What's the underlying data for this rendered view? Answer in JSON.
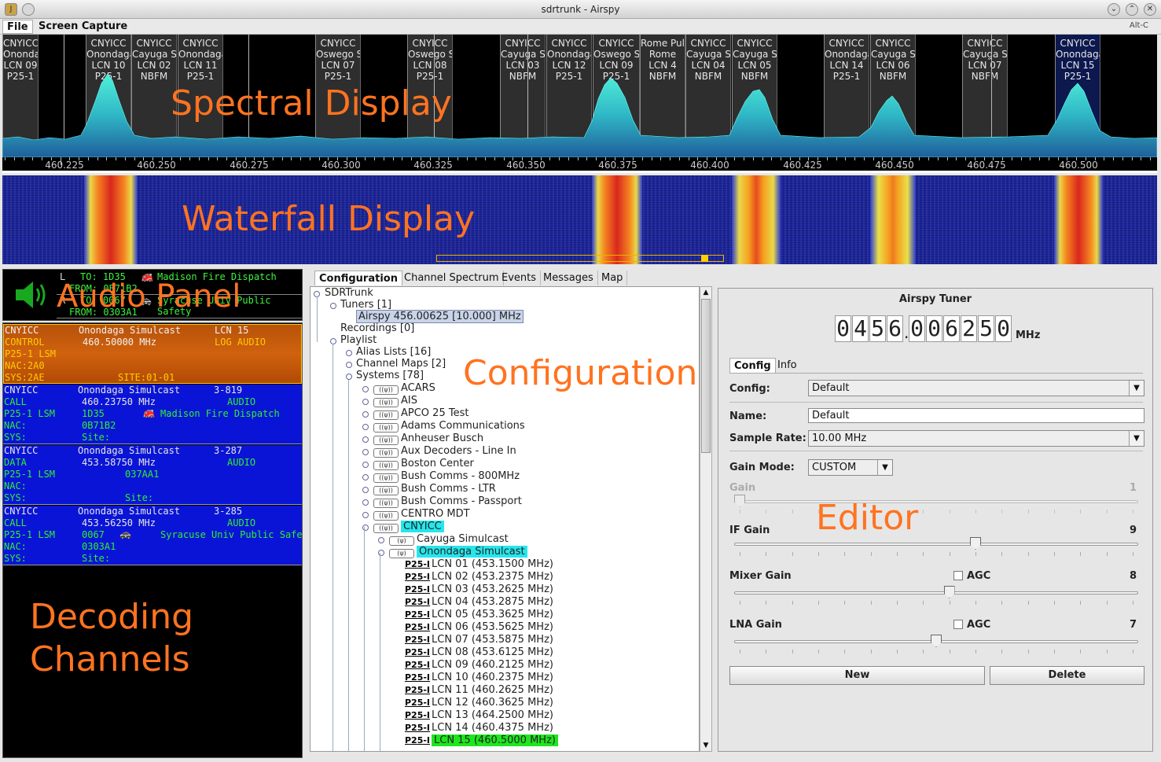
{
  "window": {
    "title": "sdrtrunk - Airspy"
  },
  "menu": {
    "file": "File",
    "screen_capture": "Screen Capture",
    "shortcut": "Alt-C"
  },
  "overlays": {
    "spectral": "Spectral Display",
    "waterfall": "Waterfall Display",
    "audio": "Audio Panel",
    "configuration": "Configuration",
    "editor": "Editor",
    "decoding_line1": "Decoding",
    "decoding_line2": "Channels"
  },
  "spectrum": {
    "frequencies": [
      "460.225",
      "460.250",
      "460.275",
      "460.300",
      "460.325",
      "460.350",
      "460.375",
      "460.400",
      "460.425",
      "460.450",
      "460.475",
      "460.500"
    ],
    "channels": [
      {
        "l1": "CNYICC",
        "l2": "Onondaga",
        "l3": "LCN 09",
        "l4": "P25-1",
        "sel": false
      },
      {
        "l1": "CNYICC",
        "l2": "Onondaga",
        "l3": "LCN 10",
        "l4": "P25-1",
        "sel": false
      },
      {
        "l1": "CNYICC",
        "l2": "Cayuga S",
        "l3": "LCN 02",
        "l4": "NBFM",
        "sel": false
      },
      {
        "l1": "CNYICC",
        "l2": "Onondaga",
        "l3": "LCN 11",
        "l4": "P25-1",
        "sel": false
      },
      {
        "l1": "CNYICC",
        "l2": "Oswego S",
        "l3": "LCN 07",
        "l4": "P25-1",
        "sel": false
      },
      {
        "l1": "CNYICC",
        "l2": "Oswego S",
        "l3": "LCN 08",
        "l4": "P25-1",
        "sel": false
      },
      {
        "l1": "CNYICC",
        "l2": "Cayuga S",
        "l3": "LCN 03",
        "l4": "NBFM",
        "sel": false
      },
      {
        "l1": "CNYICC",
        "l2": "Onondaga",
        "l3": "LCN 12",
        "l4": "P25-1",
        "sel": false
      },
      {
        "l1": "CNYICC",
        "l2": "Oswego S",
        "l3": "LCN 09",
        "l4": "P25-1",
        "sel": false
      },
      {
        "l1": "Rome Pul",
        "l2": "Rome",
        "l3": "LCN 4",
        "l4": "NBFM",
        "sel": false
      },
      {
        "l1": "CNYICC",
        "l2": "Cayuga S",
        "l3": "LCN 04",
        "l4": "NBFM",
        "sel": false
      },
      {
        "l1": "CNYICC",
        "l2": "Cayuga S",
        "l3": "LCN 05",
        "l4": "NBFM",
        "sel": false
      },
      {
        "l1": "CNYICC",
        "l2": "Onondaga",
        "l3": "LCN 14",
        "l4": "P25-1",
        "sel": false
      },
      {
        "l1": "CNYICC",
        "l2": "Cayuga S",
        "l3": "LCN 06",
        "l4": "NBFM",
        "sel": false
      },
      {
        "l1": "CNYICC",
        "l2": "Cayuga S",
        "l3": "LCN 07",
        "l4": "NBFM",
        "sel": false
      },
      {
        "l1": "CNYICC",
        "l2": "Onondaga",
        "l3": "LCN 15",
        "l4": "P25-1",
        "sel": true
      }
    ]
  },
  "audio": {
    "row1": {
      "ch": "L",
      "to": "TO: 1D35",
      "alias": "Madison Fire Dispatch",
      "from": "FROM: 0B71B2"
    },
    "row2": {
      "ch": "R",
      "to": "TO: 0067",
      "alias": "Syracuse Univ Public Safety",
      "from": "FROM: 0303A1"
    }
  },
  "decode": [
    {
      "l1a": "CNYICC",
      "l1b": "Onondaga Simulcast",
      "l1c": "LCN 15",
      "l2a": "CONTROL",
      "l2b": "460.50000 MHz",
      "l2c": "LOG AUDIO",
      "l3a": "P25-1 LSM",
      "l3b": "",
      "l3c": "",
      "l4a": "NAC:2A0",
      "l4b": "",
      "l5a": "SYS:2AE",
      "l5b": "SITE:01-01"
    },
    {
      "l1a": "CNYICC",
      "l1b": "Onondaga Simulcast",
      "l1c": "3-819",
      "l2a": "CALL",
      "l2b": "460.23750 MHz",
      "l2c": "AUDIO",
      "l3a": "P25-1 LSM",
      "l3b": "1D35",
      "l3c": "Madison Fire Dispatch",
      "l4a": "NAC:",
      "l4b": "0B71B2",
      "l5a": "SYS:",
      "l5b": "Site:"
    },
    {
      "l1a": "CNYICC",
      "l1b": "Onondaga Simulcast",
      "l1c": "3-287",
      "l2a": "DATA",
      "l2b": "453.58750 MHz",
      "l2c": "AUDIO",
      "l3a": "P25-1 LSM",
      "l3b": "037AA1",
      "l3c": "",
      "l4a": "NAC:",
      "l4b": "",
      "l5a": "SYS:",
      "l5b": "Site:"
    },
    {
      "l1a": "CNYICC",
      "l1b": "Onondaga Simulcast",
      "l1c": "3-285",
      "l2a": "CALL",
      "l2b": "453.56250 MHz",
      "l2c": "AUDIO",
      "l3a": "P25-1 LSM",
      "l3b": "0067",
      "l3c": "Syracuse Univ Public Safety",
      "l4a": "NAC:",
      "l4b": "0303A1",
      "l5a": "SYS:",
      "l5b": "Site:"
    }
  ],
  "tabs": [
    "Configuration",
    "Channel Spectrum",
    "Events",
    "Messages",
    "Map"
  ],
  "tree": {
    "root": "SDRTrunk",
    "tuners": "Tuners [1]",
    "airspy": "Airspy  456.00625 [10.000] MHz",
    "recordings": "Recordings [0]",
    "playlist": "Playlist",
    "alias": "Alias Lists [16]",
    "maps": "Channel Maps [2]",
    "systems": "Systems [78]",
    "systems_list": [
      "ACARS",
      "AIS",
      "APCO 25 Test",
      "Adams Communications",
      "Anheuser Busch",
      "Aux Decoders - Line In",
      "Boston Center",
      "Bush Comms - 800MHz",
      "Bush Comms - LTR",
      "Bush Comms - Passport",
      "CENTRO MDT",
      "CNYICC"
    ],
    "sites": [
      "Cayuga Simulcast",
      "Onondaga Simulcast"
    ],
    "p25_tag": "P25-I",
    "lcns": [
      "LCN 01 (453.1500 MHz)",
      "LCN 02 (453.2375 MHz)",
      "LCN 03 (453.2625 MHz)",
      "LCN 04 (453.2875 MHz)",
      "LCN 05 (453.3625 MHz)",
      "LCN 06 (453.5625 MHz)",
      "LCN 07 (453.5875 MHz)",
      "LCN 08 (453.6125 MHz)",
      "LCN 09 (460.2125 MHz)",
      "LCN 10 (460.2375 MHz)",
      "LCN 11 (460.2625 MHz)",
      "LCN 12 (460.3625 MHz)",
      "LCN 13 (464.2500 MHz)",
      "LCN 14 (460.4375 MHz)",
      "LCN 15 (460.5000 MHz)"
    ]
  },
  "editor": {
    "title": "Airspy Tuner",
    "freq_digits": [
      "0",
      "4",
      "5",
      "6",
      ".",
      "0",
      "0",
      "6",
      "2",
      "5",
      "0"
    ],
    "freq_unit": "MHz",
    "tab_config": "Config",
    "tab_info": "Info",
    "config_label": "Config:",
    "config_value": "Default",
    "name_label": "Name:",
    "name_value": "Default",
    "rate_label": "Sample Rate:",
    "rate_value": "10.00 MHz",
    "mode_label": "Gain Mode:",
    "mode_value": "CUSTOM",
    "gain_label": "Gain",
    "gain_value": "1",
    "if_label": "IF Gain",
    "if_value": "9",
    "mixer_label": "Mixer Gain",
    "mixer_value": "8",
    "mixer_agc": "AGC",
    "lna_label": "LNA Gain",
    "lna_value": "7",
    "lna_agc": "AGC",
    "new_label": "New",
    "delete_label": "Delete"
  }
}
